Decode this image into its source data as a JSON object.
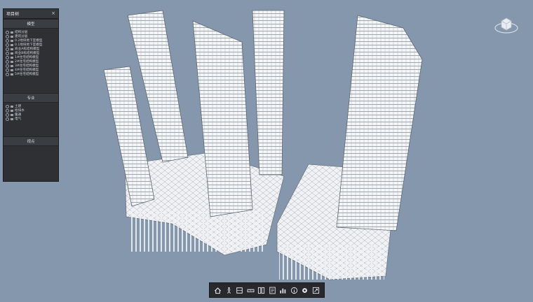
{
  "panel": {
    "title": "项目树",
    "close": "×",
    "sections": [
      {
        "title": "模型",
        "items": [
          "结构分层",
          "建筑分层",
          "0.2地块地下室模型",
          "0.1地块地下室模型",
          "商业A栋结构模型",
          "商业B栋结构模型",
          "1#住宅结构模型",
          "2#住宅结构模型",
          "3#住宅结构模型",
          "4#住宅结构模型",
          "5#住宅结构模型"
        ]
      },
      {
        "title": "专业",
        "items": [
          "土建",
          "给排水",
          "暖通",
          "电气"
        ]
      },
      {
        "title": "视点",
        "items": []
      }
    ]
  },
  "toolbar": {
    "buttons": [
      {
        "icon": "home-icon"
      },
      {
        "icon": "walk-icon"
      },
      {
        "icon": "section-box-icon"
      },
      {
        "icon": "measure-icon"
      },
      {
        "icon": "explode-icon"
      },
      {
        "icon": "properties-icon"
      },
      {
        "icon": "chart-icon"
      },
      {
        "icon": "info-icon"
      },
      {
        "icon": "settings-icon"
      },
      {
        "icon": "fullscreen-icon"
      }
    ]
  },
  "colors": {
    "background": "#8597ad",
    "panel": "#2e3034",
    "toolbar": "#27292d"
  }
}
